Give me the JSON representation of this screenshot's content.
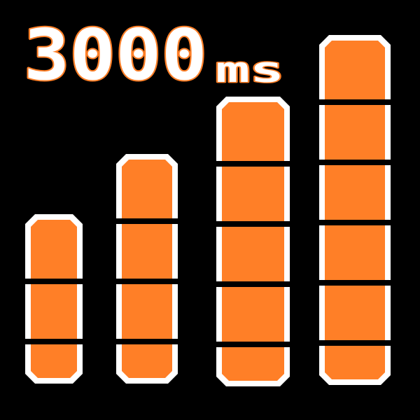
{
  "readout": {
    "value": "3000",
    "unit": "ms"
  },
  "colors": {
    "background": "#000000",
    "bar_fill": "#ff7f27",
    "bar_outline": "#ffffff",
    "divider": "#000000",
    "text_fill": "#ffffff",
    "text_stroke": "#ff7f27"
  },
  "bars": [
    {
      "segments": 3
    },
    {
      "segments": 4
    },
    {
      "segments": 5
    },
    {
      "segments": 6
    }
  ]
}
